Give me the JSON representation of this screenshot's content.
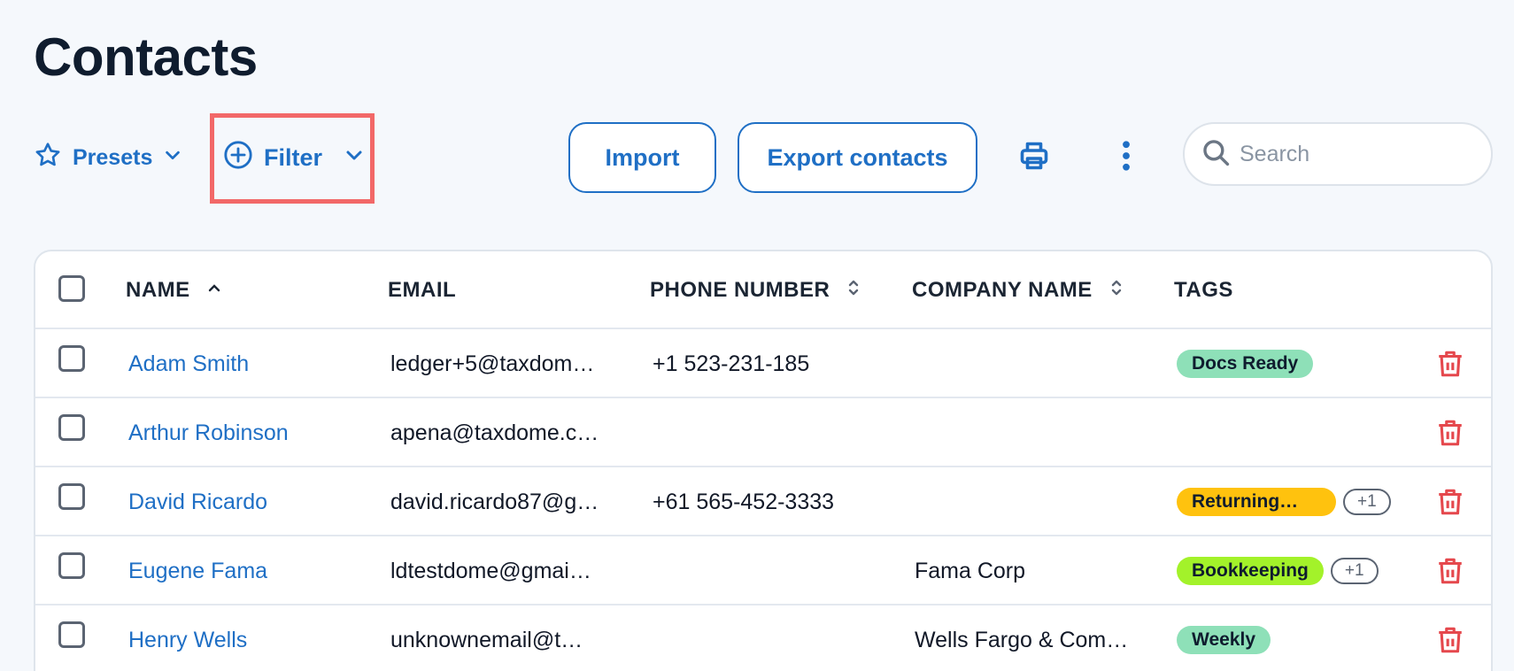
{
  "page": {
    "title": "Contacts"
  },
  "toolbar": {
    "presets_label": "Presets",
    "filter_label": "Filter",
    "import_label": "Import",
    "export_label": "Export contacts",
    "search_placeholder": "Search"
  },
  "table": {
    "headers": {
      "name": "NAME",
      "email": "EMAIL",
      "phone": "PHONE NUMBER",
      "company": "COMPANY NAME",
      "tags": "TAGS"
    },
    "rows": [
      {
        "name": "Adam Smith",
        "email": "ledger+5@taxdom…",
        "phone": "+1 523-231-185",
        "company": "",
        "tag": "Docs Ready",
        "tag_color": "#8ee0b8",
        "extra": ""
      },
      {
        "name": "Arthur Robinson",
        "email": "apena@taxdome.c…",
        "phone": "",
        "company": "",
        "tag": "",
        "tag_color": "",
        "extra": ""
      },
      {
        "name": "David Ricardo",
        "email": "david.ricardo87@g…",
        "phone": "+61 565-452-3333",
        "company": "",
        "tag": "Returning…",
        "tag_color": "#ffc20e",
        "extra": "+1"
      },
      {
        "name": "Eugene Fama",
        "email": "ldtestdome@gmai…",
        "phone": "",
        "company": "Fama Corp",
        "tag": "Bookkeeping",
        "tag_color": "#a3f22a",
        "extra": "+1"
      },
      {
        "name": "Henry Wells",
        "email": "unknownemail@t…",
        "phone": "",
        "company": "Wells Fargo & Com…",
        "tag": "Weekly",
        "tag_color": "#8ee0b8",
        "extra": ""
      }
    ]
  },
  "colors": {
    "accent": "#1f6fc5",
    "danger": "#e5484d",
    "highlight": "#f26868"
  },
  "icons": {
    "presets": "star-icon",
    "filter": "plus-circle-icon",
    "dropdown": "chevron-down-icon",
    "print": "printer-icon",
    "more": "more-vertical-icon",
    "search": "search-icon",
    "delete": "trash-icon",
    "sort": "sort-icon"
  }
}
